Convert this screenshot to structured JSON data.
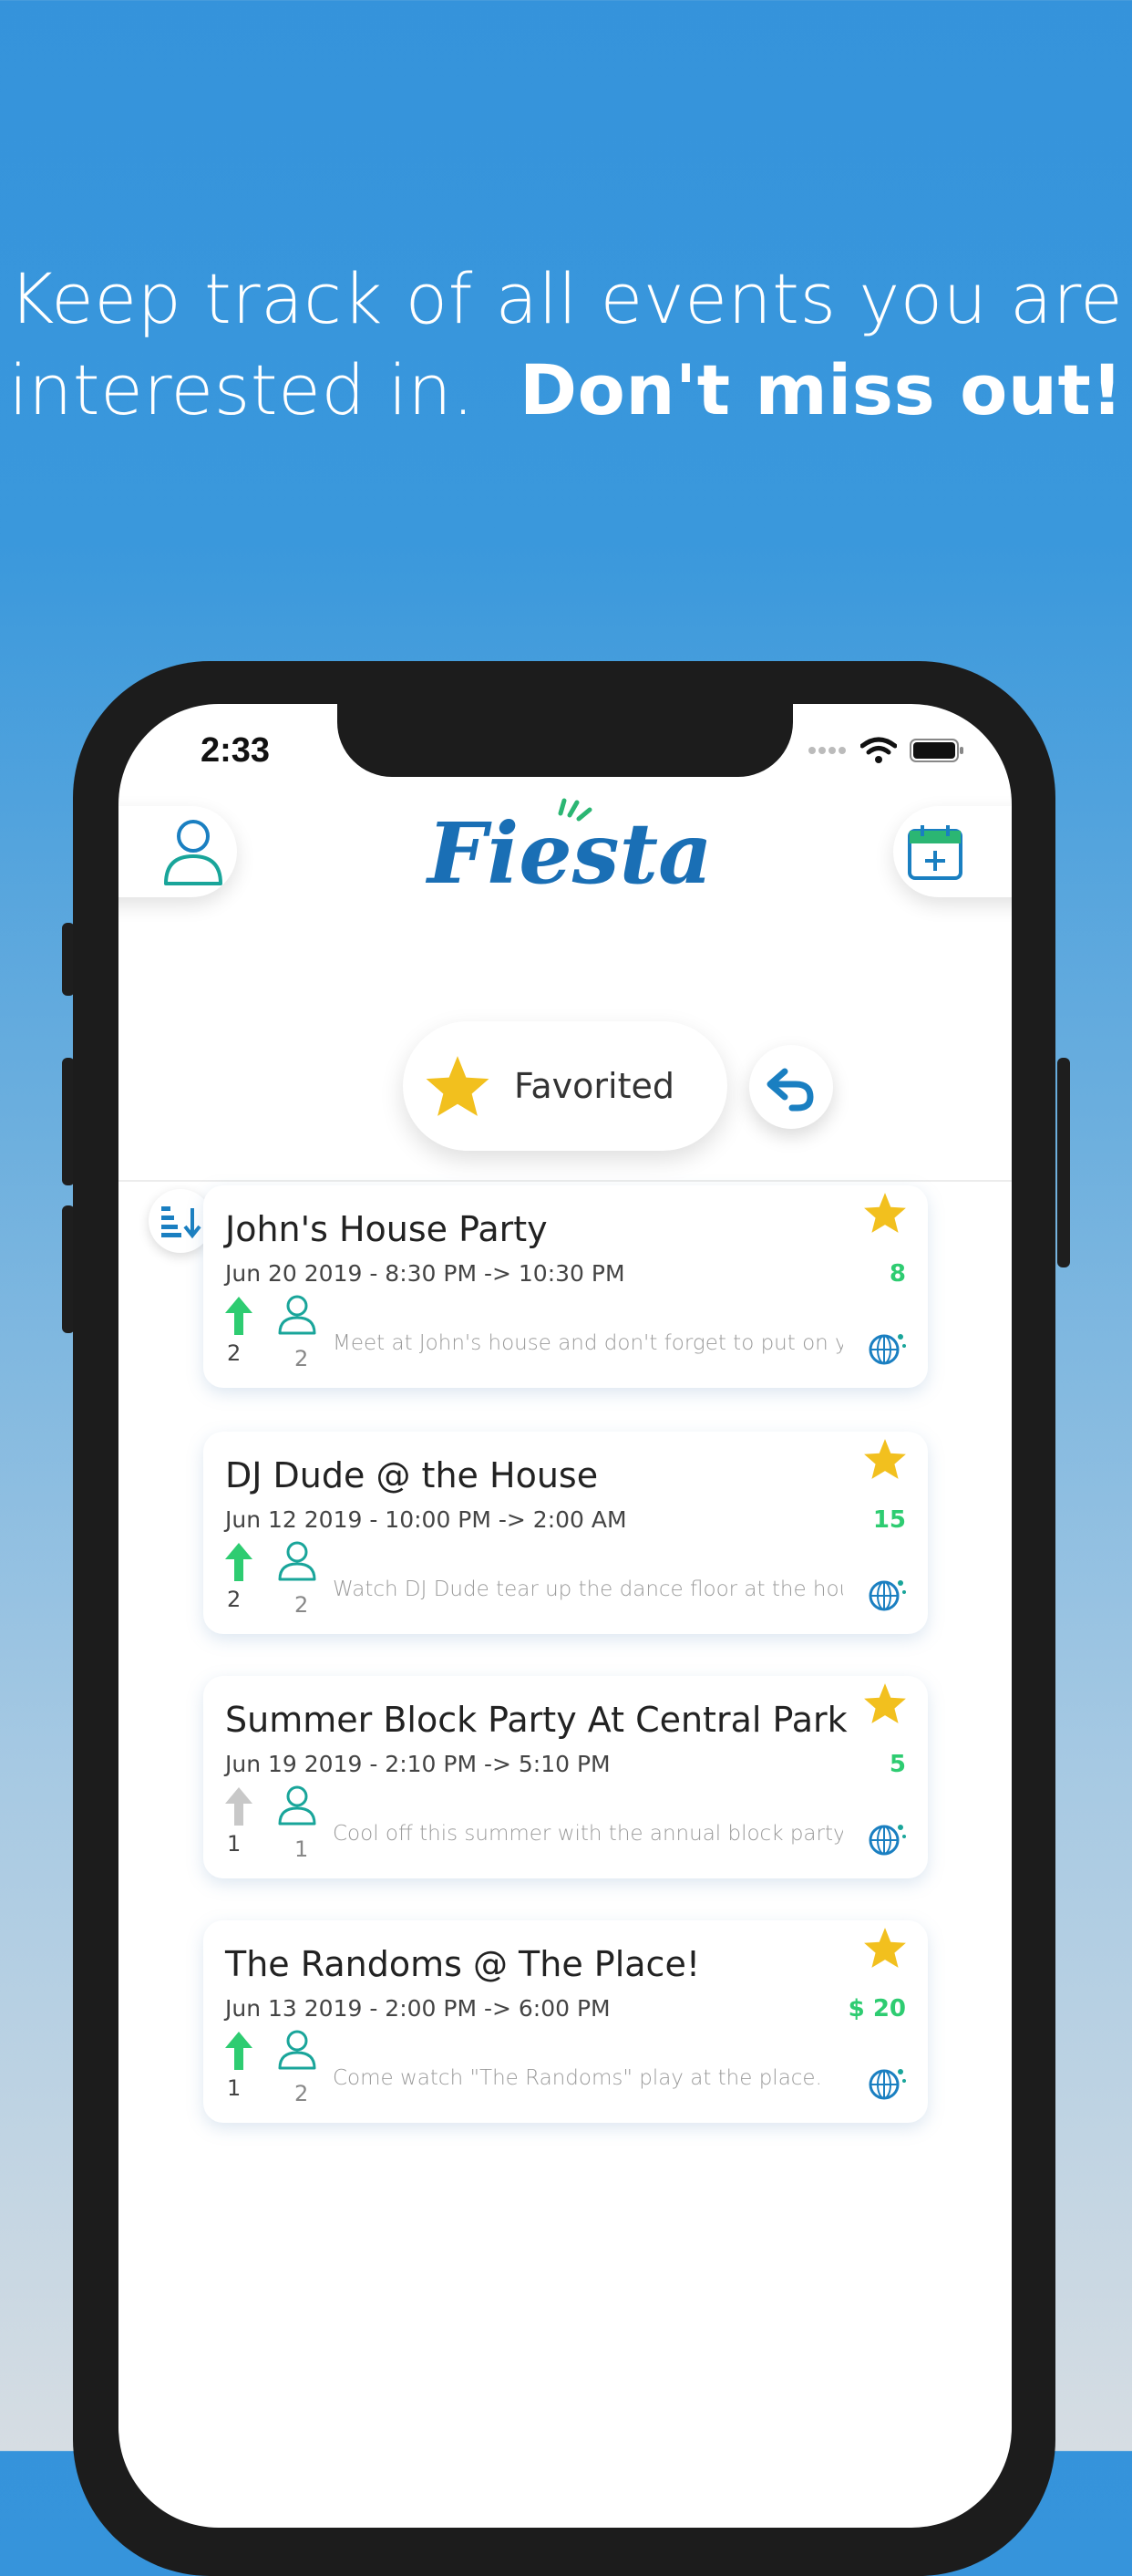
{
  "headline": {
    "line1": "Keep track of all events you are",
    "line2_regular": "interested in.",
    "line2_bold": "Don't miss out!"
  },
  "status_bar": {
    "time": "2:33"
  },
  "header": {
    "logo_text": "Fiesta!",
    "profile_icon": "person-icon",
    "calendar_icon": "calendar-add-icon"
  },
  "filter": {
    "label": "Favorited",
    "icon": "star-icon",
    "undo_icon": "undo-icon",
    "sort_icon": "sort-icon"
  },
  "events": [
    {
      "title": "John's House Party",
      "date": "Jun 20 2019  -  8:30 PM -> 10:30 PM",
      "count": "8",
      "upvotes": "2",
      "attendees": "2",
      "description": "Meet at John's house and don't forget to put on your",
      "upvoted": true
    },
    {
      "title": "DJ Dude @ the House",
      "date": "Jun 12 2019  -  10:00 PM -> 2:00 AM",
      "count": "15",
      "upvotes": "2",
      "attendees": "2",
      "description": "Watch DJ Dude tear up the dance floor at the house",
      "upvoted": true
    },
    {
      "title": "Summer Block Party At Central Park",
      "date": "Jun 19 2019  -  2:10 PM -> 5:10 PM",
      "count": "5",
      "upvotes": "1",
      "attendees": "1",
      "description": "Cool off this summer with the annual block party.",
      "upvoted": false
    },
    {
      "title": "The Randoms @ The Place!",
      "date": "Jun 13 2019  -  2:00 PM -> 6:00 PM",
      "count": "$ 20",
      "upvotes": "1",
      "attendees": "2",
      "description": "Come watch \"The Randoms\" play at the place.",
      "upvoted": true
    }
  ],
  "colors": {
    "accent_blue": "#1a7fc1",
    "accent_teal": "#19a59a",
    "star_gold": "#f2c01e",
    "upvote_green": "#2ecc71",
    "upvote_gray": "#c8c8c8"
  }
}
